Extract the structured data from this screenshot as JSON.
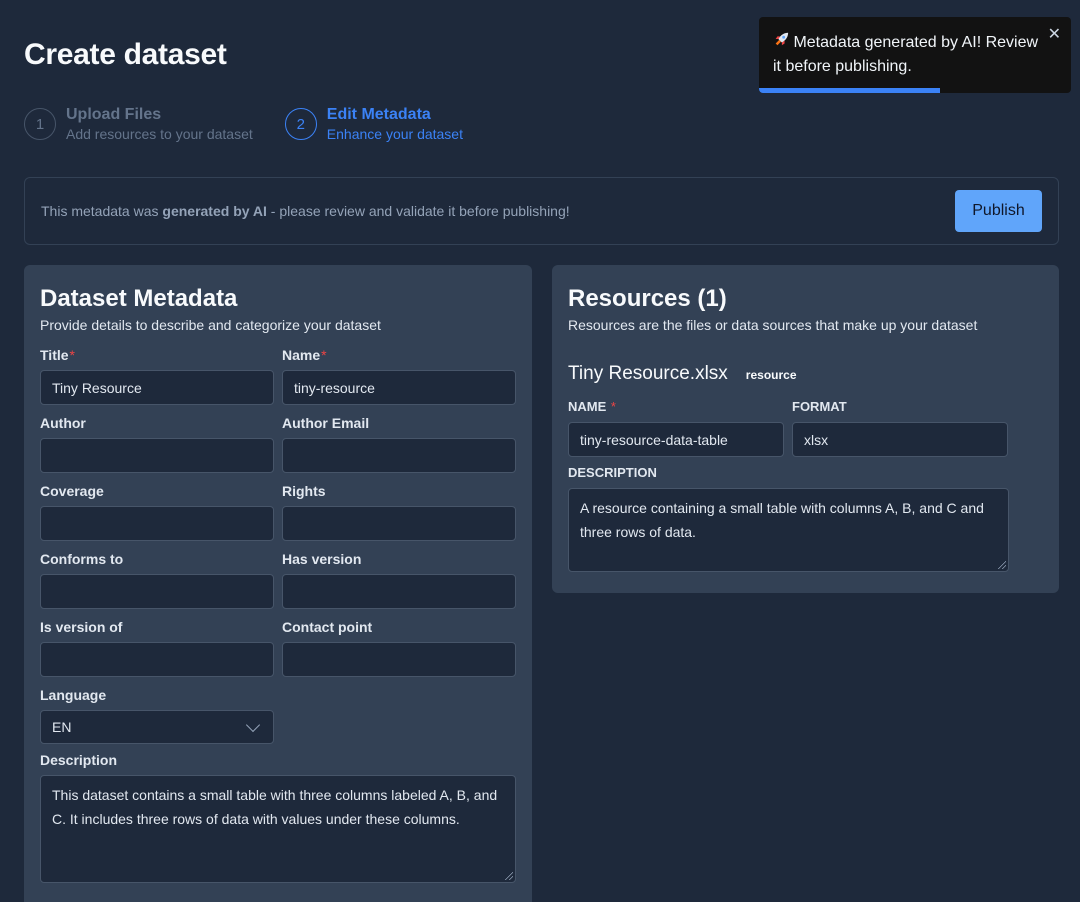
{
  "page": {
    "title": "Create dataset"
  },
  "stepper": [
    {
      "num": "1",
      "title": "Upload Files",
      "sub": "Add resources to your dataset"
    },
    {
      "num": "2",
      "title": "Edit Metadata",
      "sub": "Enhance your dataset"
    }
  ],
  "banner": {
    "pre": "This metadata was ",
    "bold": "generated by AI",
    "post": " - please review and validate it before publishing!",
    "publish_label": "Publish"
  },
  "metadata": {
    "title": "Dataset Metadata",
    "subtitle": "Provide details to describe and categorize your dataset",
    "fields": {
      "title": {
        "label": "Title",
        "value": "Tiny Resource"
      },
      "name": {
        "label": "Name",
        "value": "tiny-resource"
      },
      "author": {
        "label": "Author",
        "value": ""
      },
      "author_email": {
        "label": "Author Email",
        "value": ""
      },
      "coverage": {
        "label": "Coverage",
        "value": ""
      },
      "rights": {
        "label": "Rights",
        "value": ""
      },
      "conforms_to": {
        "label": "Conforms to",
        "value": ""
      },
      "has_version": {
        "label": "Has version",
        "value": ""
      },
      "is_version_of": {
        "label": "Is version of",
        "value": ""
      },
      "contact_point": {
        "label": "Contact point",
        "value": ""
      },
      "language": {
        "label": "Language",
        "value": "EN"
      },
      "description": {
        "label": "Description",
        "value": "This dataset contains a small table with three columns labeled A, B, and C. It includes three rows of data with values under these columns."
      }
    },
    "required_mark": "*"
  },
  "resources": {
    "title": "Resources (1)",
    "subtitle": "Resources are the files or data sources that make up your dataset",
    "items": [
      {
        "filename": "Tiny Resource.xlsx",
        "tag": "resource",
        "name_label": "NAME",
        "name": "tiny-resource-data-table",
        "format_label": "FORMAT",
        "format": "xlsx",
        "description_label": "DESCRIPTION",
        "description": "A resource containing a small table with columns A, B, and C and three rows of data."
      }
    ]
  },
  "toast": {
    "icon": "rocket-icon",
    "message": "Metadata generated by AI! Review it before publishing.",
    "close": "✕",
    "progress": 0.58
  },
  "colors": {
    "background": "#1e293b",
    "card": "#334155",
    "accent": "#3b82f6",
    "button": "#60a5fa",
    "required": "#ef4444"
  }
}
